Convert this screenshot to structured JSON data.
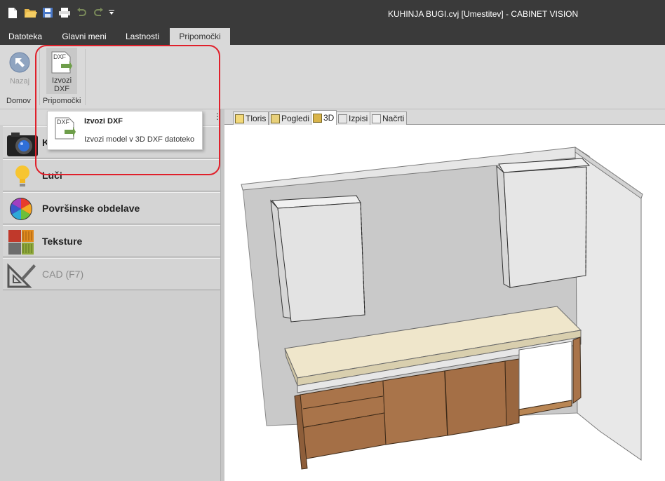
{
  "window": {
    "title": "KUHINJA BUGI.cvj [Umestitev] - CABINET VISION"
  },
  "quick_access": {
    "icons": [
      "new-file-icon",
      "open-folder-icon",
      "save-icon",
      "print-icon",
      "undo-icon",
      "redo-icon",
      "customize-dropdown-icon"
    ]
  },
  "ribbon_tabs": [
    {
      "label": "Datoteka"
    },
    {
      "label": "Glavni meni"
    },
    {
      "label": "Lastnosti"
    },
    {
      "label": "Pripomočki",
      "active": true
    }
  ],
  "ribbon": {
    "back_button": {
      "label": "Nazaj",
      "enabled": false
    },
    "export_button": {
      "label_line1": "Izvozi",
      "label_line2": "DXF",
      "icon_text": "DXF"
    },
    "groups": [
      {
        "label": "Domov"
      },
      {
        "label": "Pripomočki"
      }
    ]
  },
  "tooltip": {
    "icon_text": "DXF",
    "title": "Izvozi DXF",
    "description": "Izvozi model v 3D DXF datoteko"
  },
  "left_panel": {
    "items": [
      {
        "label": "K",
        "icon": "camera-icon"
      },
      {
        "label": "Luči",
        "icon": "lightbulb-icon"
      },
      {
        "label": "Površinske obdelave",
        "icon": "color-wheel-icon"
      },
      {
        "label": "Teksture",
        "icon": "textures-icon"
      },
      {
        "label": "CAD (F7)",
        "icon": "cad-tools-icon",
        "disabled": true
      }
    ]
  },
  "view_tabs": [
    {
      "label": "Tloris"
    },
    {
      "label": "Pogledi"
    },
    {
      "label": "3D",
      "active": true
    },
    {
      "label": "Izpisi"
    },
    {
      "label": "Načrti"
    }
  ],
  "colors": {
    "titlebar": "#3a3a3a",
    "ribbon": "#d9d9d9",
    "highlight": "#e0202b",
    "wood": "#a9744a",
    "countertop": "#efe6cb",
    "wall": "#c9c9c9"
  }
}
